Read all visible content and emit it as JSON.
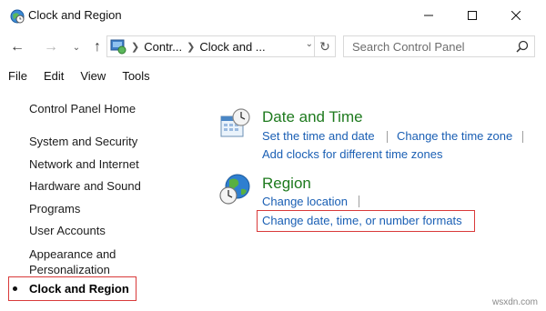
{
  "window": {
    "title": "Clock and Region",
    "icon": "clock-region-icon",
    "controls": [
      "minimize-icon",
      "maximize-icon",
      "close-icon"
    ]
  },
  "nav": {
    "back": "←",
    "forward": "→",
    "recent": "⌄",
    "up": "↑"
  },
  "address": {
    "crumbs": [
      "Contr...",
      "Clock and ..."
    ]
  },
  "search": {
    "placeholder": "Search Control Panel"
  },
  "menu": [
    "File",
    "Edit",
    "View",
    "Tools"
  ],
  "sidebar": {
    "items": [
      "Control Panel Home",
      "System and Security",
      "Network and Internet",
      "Hardware and Sound",
      "Programs",
      "User Accounts",
      "Appearance and Personalization"
    ],
    "current": "Clock and Region"
  },
  "main": {
    "date_time": {
      "title": "Date and Time",
      "links": [
        "Set the time and date",
        "Change the time zone",
        "Add clocks for different time zones"
      ]
    },
    "region": {
      "title": "Region",
      "links": [
        "Change location",
        "Change date, time, or number formats"
      ]
    }
  },
  "colors": {
    "section_title": "#1e7a1e",
    "link": "#1a5fb4",
    "highlight_box": "#d93a3a"
  },
  "watermark": "wsxdn.com"
}
